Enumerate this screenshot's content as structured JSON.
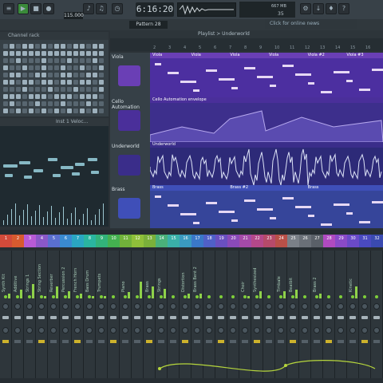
{
  "toolbar": {
    "time": "6:16:20",
    "bpm": "115.000",
    "pattern": "Pattern 28",
    "news": "Click for online news",
    "cpu_readout": [
      "667 MB",
      "35"
    ]
  },
  "channel_rack": {
    "title": "Channel rack",
    "rows": [
      [
        0,
        1,
        0,
        1,
        1,
        0,
        1,
        0,
        1,
        1,
        0,
        1,
        1,
        0,
        1,
        1
      ],
      [
        1,
        1,
        1,
        1,
        1,
        1,
        1,
        1,
        1,
        1,
        1,
        1,
        1,
        1,
        1,
        1
      ],
      [
        0,
        0,
        1,
        0,
        0,
        0,
        1,
        0,
        0,
        0,
        1,
        0,
        0,
        0,
        1,
        0
      ],
      [
        1,
        0,
        0,
        1,
        0,
        0,
        1,
        0,
        0,
        1,
        0,
        0,
        1,
        0,
        0,
        1
      ],
      [
        0,
        1,
        1,
        0,
        0,
        1,
        1,
        0,
        0,
        1,
        1,
        0,
        0,
        1,
        1,
        0
      ],
      [
        1,
        1,
        0,
        1,
        1,
        0,
        1,
        1,
        0,
        1,
        1,
        0,
        1,
        1,
        0,
        1
      ],
      [
        0,
        0,
        0,
        1,
        0,
        0,
        0,
        1,
        0,
        0,
        0,
        1,
        0,
        0,
        0,
        1
      ],
      [
        1,
        1,
        1,
        0,
        1,
        1,
        1,
        0,
        1,
        1,
        1,
        0,
        1,
        1,
        1,
        0
      ],
      [
        0,
        1,
        0,
        0,
        0,
        1,
        0,
        0,
        0,
        1,
        0,
        0,
        0,
        1,
        0,
        0
      ],
      [
        1,
        0,
        1,
        0,
        1,
        0,
        1,
        0,
        1,
        0,
        1,
        0,
        1,
        0,
        1,
        0
      ]
    ]
  },
  "piano_roll": {
    "title": "Inst 1 Veloc..."
  },
  "playlist": {
    "title": "Playlist > Underworld",
    "ruler": [
      "2",
      "3",
      "4",
      "5",
      "6",
      "7",
      "8",
      "9",
      "10",
      "11",
      "12",
      "13",
      "14",
      "15",
      "16"
    ],
    "tracks": [
      {
        "name": "Viola",
        "clips": [
          "Viola",
          "Viola",
          "Viola",
          "Viola",
          "Viola #2",
          "Viola #3"
        ],
        "color": "#6a3fb5"
      },
      {
        "name": "Cello Automation",
        "clips": [
          "Cello Automation envelope"
        ],
        "color": "#4a2f9a"
      },
      {
        "name": "Underworld",
        "clips": [
          "Underworld"
        ],
        "color": "#3a2d8a"
      },
      {
        "name": "Brass",
        "clips": [
          "Brass",
          "Brass #2",
          "Brass"
        ],
        "color": "#3f4fb8"
      }
    ]
  },
  "mixer": {
    "numbers": [
      "1",
      "2",
      "3",
      "4",
      "5",
      "6",
      "7",
      "8",
      "9",
      "10",
      "11",
      "12",
      "13",
      "14",
      "15",
      "16",
      "17",
      "18",
      "19",
      "20",
      "21",
      "22",
      "23",
      "24",
      "25",
      "26",
      "27",
      "28",
      "29",
      "30",
      "31",
      "32"
    ],
    "strips": [
      "Synth Kit",
      "Additive",
      "Strings 1",
      "String Section",
      "Reverber",
      "Percussion 2",
      "French Horn",
      "Bass Drum",
      "Trumpets",
      "",
      "Piano",
      "",
      "Brass",
      "Strings",
      "",
      "Distortion",
      "Brass Bent 2",
      "",
      "",
      "",
      "Choir",
      "Synthesized",
      "",
      "Timbale",
      "Beatbit",
      "",
      "Brass 2",
      "",
      "",
      "Kinetic",
      "",
      ""
    ],
    "levels": [
      0.2,
      0.35,
      0.6,
      0.1,
      0.5,
      0.3,
      0.2,
      0.1,
      0.1,
      0,
      0.25,
      0.7,
      0.5,
      0.4,
      0,
      0.2,
      0.2,
      0,
      0,
      0,
      0.1,
      0.3,
      0,
      0.3,
      0.35,
      0,
      0.2,
      0,
      0,
      0.5,
      0,
      0
    ]
  },
  "colors": {
    "mixer_number_bg": [
      "#d24a3a",
      "#d75a2f",
      "#b75ad6",
      "#8a58c8",
      "#5a6fd0",
      "#3a8ad0",
      "#2aa6c2",
      "#2ab5a0",
      "#32b27a",
      "#44b050",
      "#71b23a",
      "#8fbf3a",
      "#7ab03a",
      "#4ab07a",
      "#3ab0a8",
      "#3a9ac0",
      "#3a78c8",
      "#5060c8",
      "#6a50c0",
      "#8a4ab8",
      "#a44aa8",
      "#b4488a",
      "#b64a6a",
      "#b85048",
      "#7a8088",
      "#6a7078",
      "#5a6068",
      "#b04ac0",
      "#8a4ac8",
      "#6a4ac8",
      "#4a4ac0",
      "#3a4ab0"
    ]
  }
}
